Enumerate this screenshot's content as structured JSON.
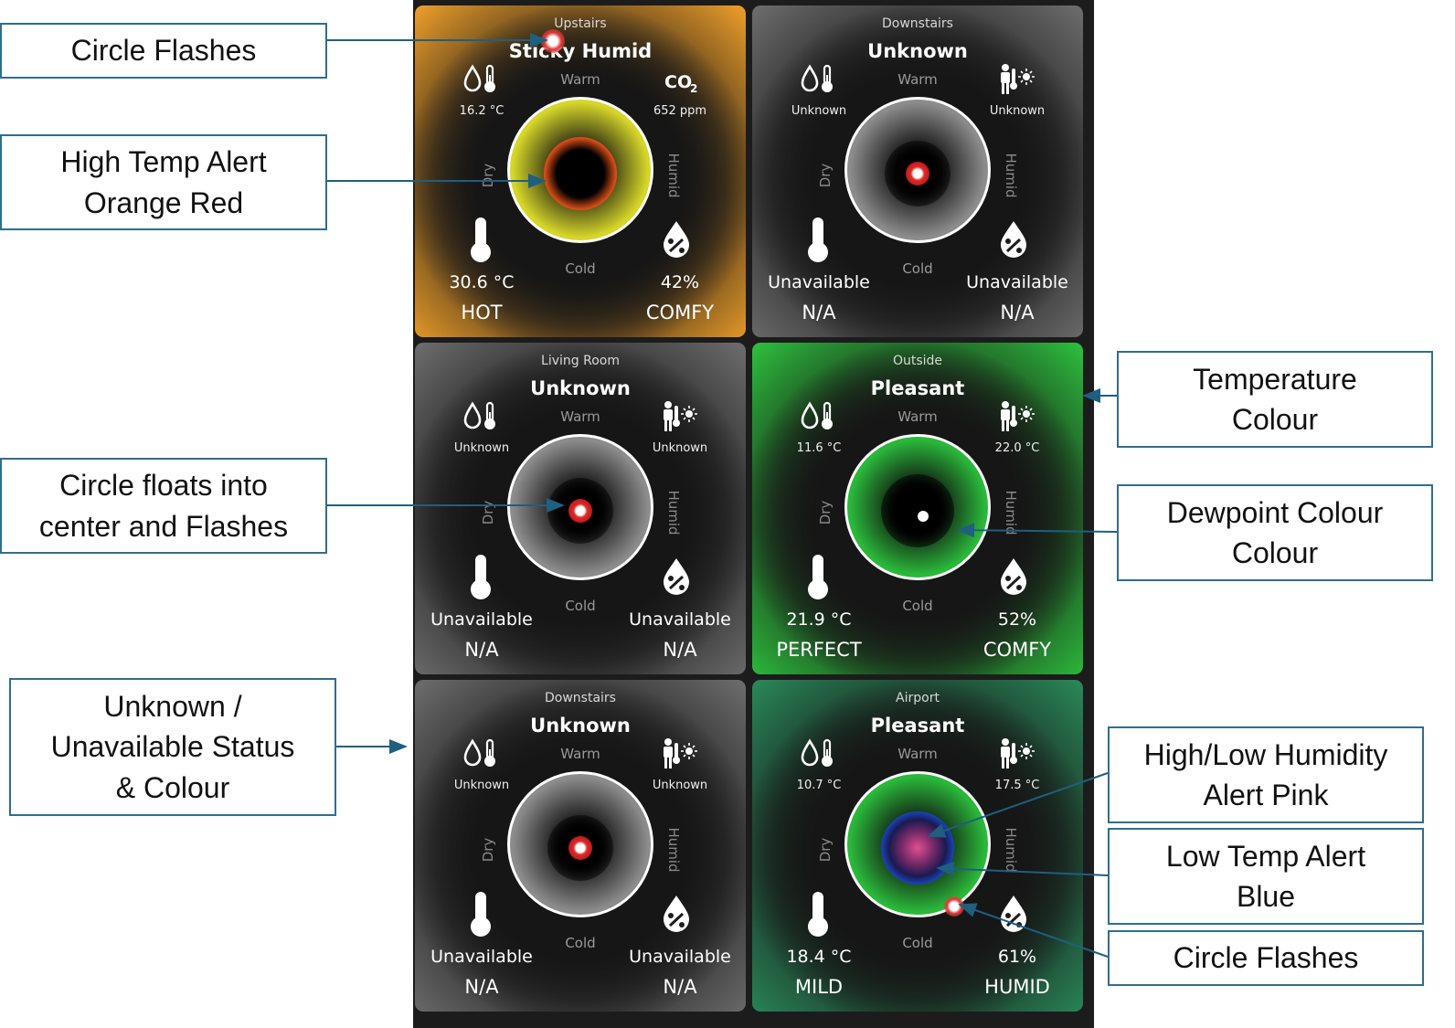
{
  "dial_labels": {
    "warm": "Warm",
    "cold": "Cold",
    "dry": "Dry",
    "humid": "Humid"
  },
  "cards": [
    {
      "location": "Upstairs",
      "condition": "Sticky Humid",
      "tl_value": "16.2 °C",
      "tr_value": "652 ppm",
      "bl_value": "30.6 °C",
      "br_value": "42%",
      "bl_status": "HOT",
      "br_status": "COMFY",
      "tr_icon": "co2-icon",
      "colors": {
        "frame": "#f0a02a",
        "dial": "#d6d62a",
        "alert": "#e0501a"
      }
    },
    {
      "location": "Downstairs",
      "condition": "Unknown",
      "tl_value": "Unknown",
      "tr_value": "Unknown",
      "bl_value": "Unavailable",
      "br_value": "Unavailable",
      "bl_status": "N/A",
      "br_status": "N/A",
      "tr_icon": "person-sun-icon",
      "colors": {
        "frame": "#6e6e6e",
        "dial": "#8c8c8c"
      }
    },
    {
      "location": "Living Room",
      "condition": "Unknown",
      "tl_value": "Unknown",
      "tr_value": "Unknown",
      "bl_value": "Unavailable",
      "br_value": "Unavailable",
      "bl_status": "N/A",
      "br_status": "N/A",
      "tr_icon": "person-sun-icon",
      "colors": {
        "frame": "#6e6e6e",
        "dial": "#8c8c8c"
      }
    },
    {
      "location": "Outside",
      "condition": "Pleasant",
      "tl_value": "11.6 °C",
      "tr_value": "22.0 °C",
      "bl_value": "21.9 °C",
      "br_value": "52%",
      "bl_status": "PERFECT",
      "br_status": "COMFY",
      "tr_icon": "person-sun-icon",
      "colors": {
        "frame": "#2ec23e",
        "dial": "#2ab83a"
      }
    },
    {
      "location": "Downstairs",
      "condition": "Unknown",
      "tl_value": "Unknown",
      "tr_value": "Unknown",
      "bl_value": "Unavailable",
      "br_value": "Unavailable",
      "bl_status": "N/A",
      "br_status": "N/A",
      "tr_icon": "person-sun-icon",
      "colors": {
        "frame": "#6e6e6e",
        "dial": "#8c8c8c"
      }
    },
    {
      "location": "Airport",
      "condition": "Pleasant",
      "tl_value": "10.7 °C",
      "tr_value": "17.5 °C",
      "bl_value": "18.4 °C",
      "br_value": "61%",
      "bl_status": "MILD",
      "br_status": "HUMID",
      "tr_icon": "person-sun-icon",
      "colors": {
        "frame": "#2a8a5a",
        "dial": "#2ab83a",
        "alert": "#1a50d8",
        "humidity_alert": "#e05090"
      }
    }
  ],
  "annotations": [
    {
      "text": "Circle Flashes"
    },
    {
      "text": "High Temp Alert\nOrange Red"
    },
    {
      "text": "Circle floats into\ncenter and Flashes"
    },
    {
      "text": "Unknown /\nUnavailable Status\n& Colour"
    },
    {
      "text": "Temperature\nColour"
    },
    {
      "text": "Dewpoint Colour\nColour"
    },
    {
      "text": "High/Low Humidity\nAlert Pink"
    },
    {
      "text": "Low Temp Alert\nBlue"
    },
    {
      "text": "Circle Flashes"
    }
  ]
}
